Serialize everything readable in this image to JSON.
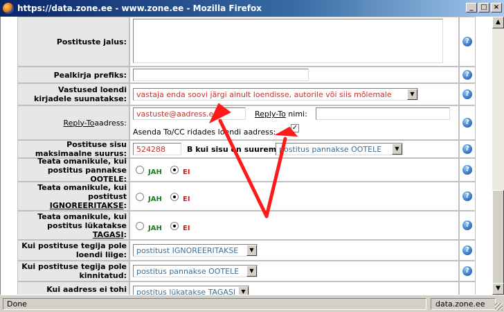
{
  "window": {
    "title": "https://data.zone.ee - www.zone.ee - Mozilla Firefox",
    "min": "_",
    "max": "□",
    "close": "×"
  },
  "status": {
    "left": "Done",
    "right": "data.zone.ee"
  },
  "help_icon": "?",
  "rows": {
    "footer": {
      "label": "Postituste jalus:",
      "value": ""
    },
    "subject_prefix": {
      "label": "Pealkirja prefiks:",
      "value": ""
    },
    "replies": {
      "label": "Vastused loendi kirjadele suunatakse:",
      "selected": "vastaja enda soovi järgi ainult loendisse, autorile või siis mõlemale"
    },
    "reply_to": {
      "label_part1": "Reply-To",
      "label_part2": " aadress:",
      "address_value": "vastuste@aadress.ee",
      "name_label_part1": "Reply-To",
      "name_label_part2": " nimi:",
      "name_value": "",
      "checkbox_label": "Asenda To/CC ridades loendi aadress:",
      "checkbox_mark": "✓"
    },
    "max_size": {
      "label": "Postituse sisu maksimaalne suurus:",
      "value": "524288",
      "suffix": "B kui sisu on suurem:",
      "selected": "postitus pannakse OOTELE"
    },
    "notify_pending": {
      "label_text": "Teata omanikule, kui postitus pannakse ",
      "label_u": "OOTELE",
      "label_end": ":",
      "yes": "JAH",
      "no": "EI"
    },
    "notify_ignored": {
      "label_text": "Teata omanikule, kui postitust ",
      "label_u": "IGNOREERITAKSE",
      "label_end": ":",
      "yes": "JAH",
      "no": "EI"
    },
    "notify_rejected": {
      "label_text": "Teata omanikule, kui postitus lükatakse ",
      "label_u": "TAGASI",
      "label_end": ":",
      "yes": "JAH",
      "no": "EI"
    },
    "non_member": {
      "label": "Kui postituse tegija pole loendi liige:",
      "selected": "postitust IGNOREERITAKSE"
    },
    "not_confirmed": {
      "label": "Kui postituse tegija pole kinnitatud:",
      "selected": "postitus pannakse OOTELE"
    },
    "forbidden_address": {
      "label": "Kui aadress ei tohi",
      "selected": "postitus lükatakse TAGASI"
    }
  },
  "colors": {
    "annotation_arrow": "#ff1a1a",
    "title_bar": "#0a246a"
  }
}
